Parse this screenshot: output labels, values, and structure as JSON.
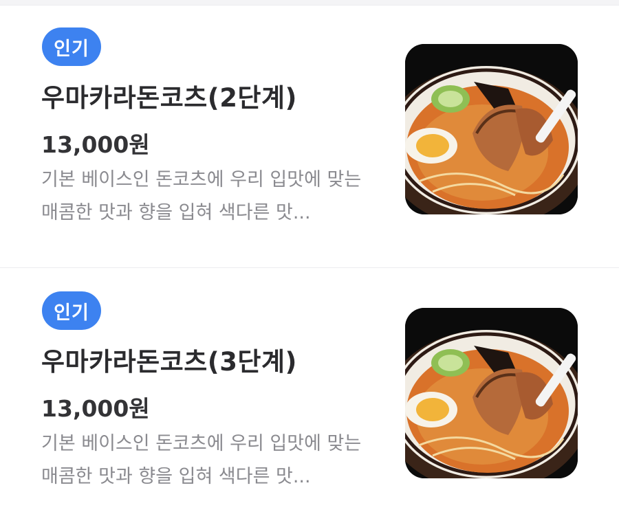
{
  "menu_items": [
    {
      "badge": "인기",
      "name": "우마카라돈코츠(2단계)",
      "price": "13,000원",
      "description": "기본 베이스인 돈코츠에 우리 입맛에 맞는 매콤한 맛과 향을 입혀 색다른 맛..."
    },
    {
      "badge": "인기",
      "name": "우마카라돈코츠(3단계)",
      "price": "13,000원",
      "description": "기본 베이스인 돈코츠에 우리 입맛에 맞는 매콤한 맛과 향을 입혀 색다른 맛..."
    }
  ],
  "colors": {
    "badge_bg": "#3d82f0",
    "name_text": "#2b2b2e",
    "desc_text": "#8a8a8f",
    "divider": "#ececef"
  },
  "icons": {
    "menu_image": "ramen-bowl-image"
  }
}
